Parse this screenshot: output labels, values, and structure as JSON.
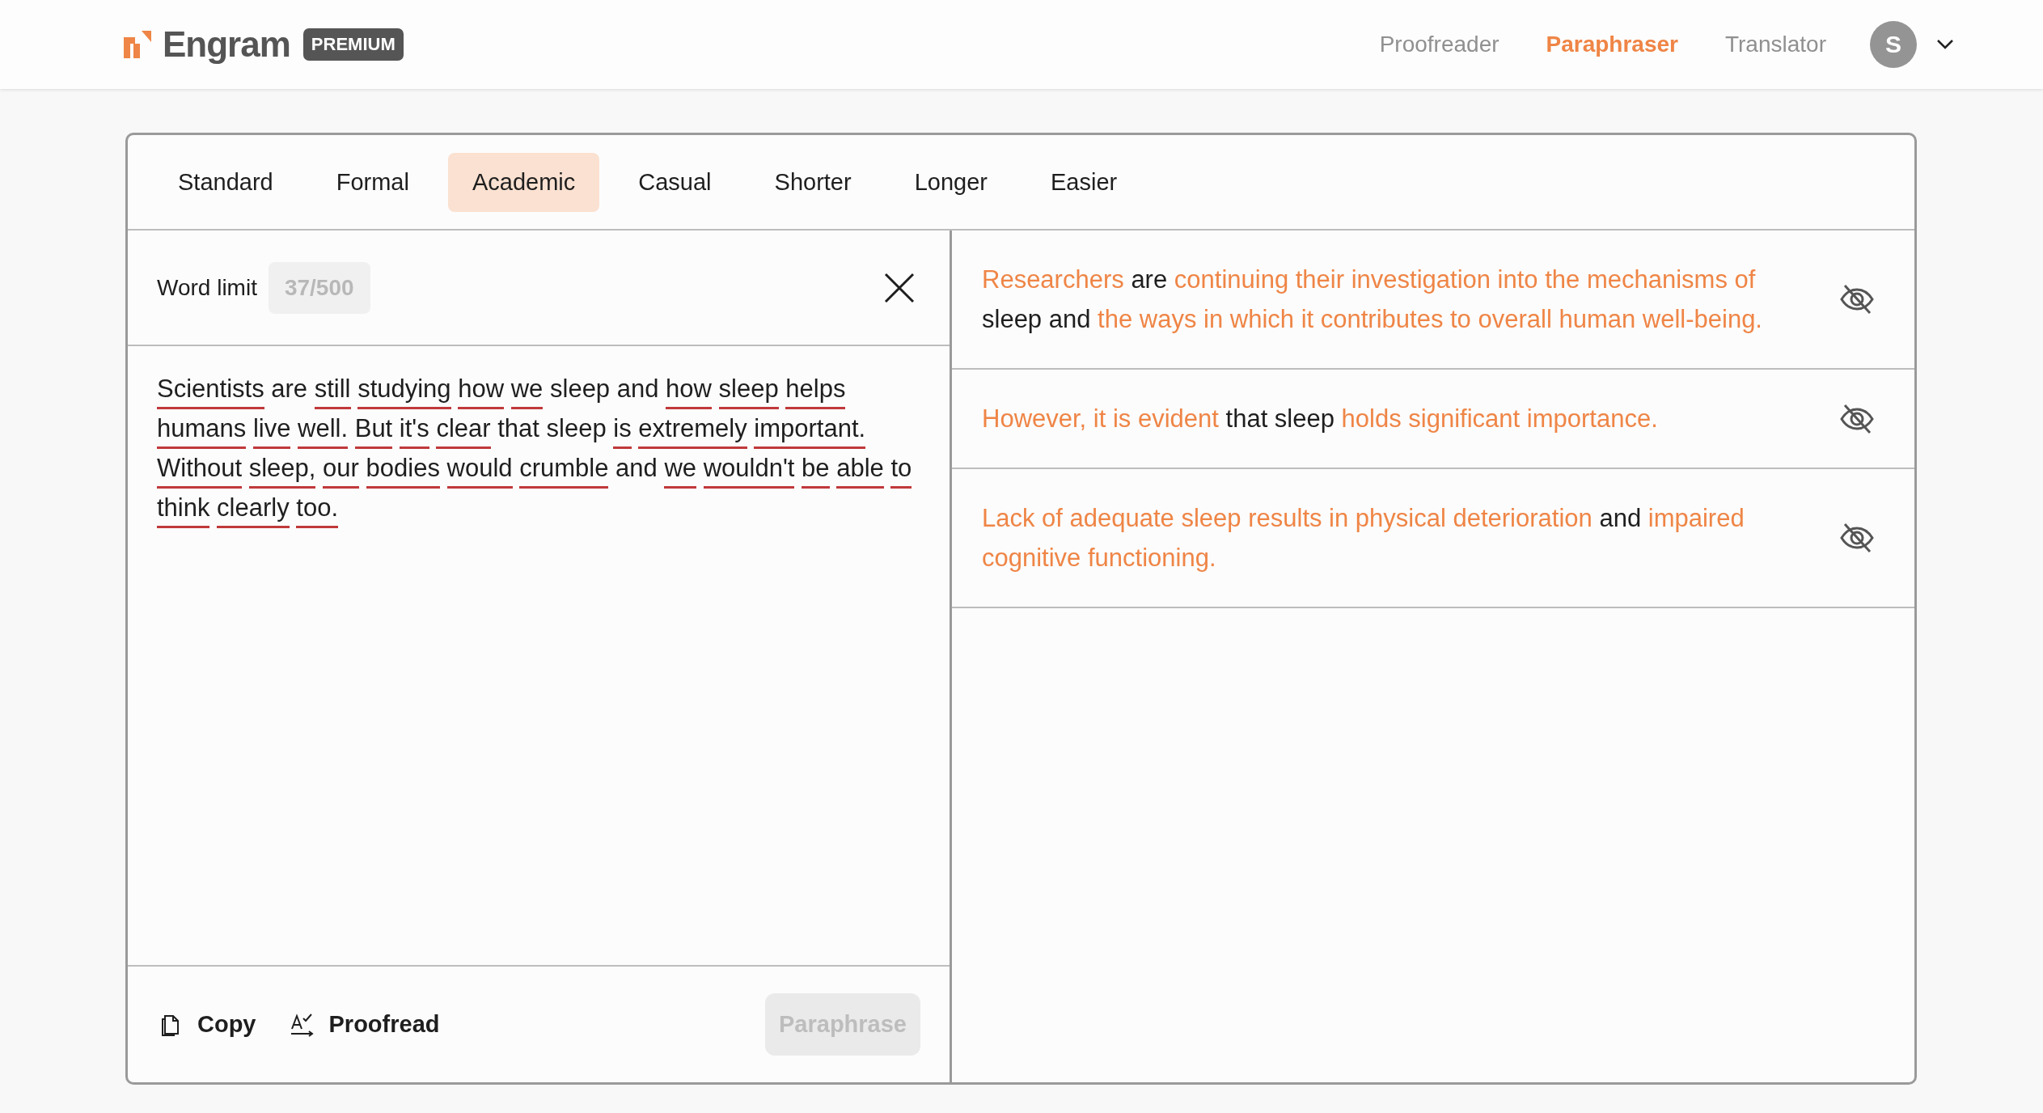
{
  "header": {
    "brand": "Engram",
    "badge": "PREMIUM",
    "nav": [
      {
        "label": "Proofreader",
        "selected": false
      },
      {
        "label": "Paraphraser",
        "selected": true
      },
      {
        "label": "Translator",
        "selected": false
      }
    ],
    "avatar": "S"
  },
  "modes": [
    {
      "label": "Standard",
      "selected": false
    },
    {
      "label": "Formal",
      "selected": false
    },
    {
      "label": "Academic",
      "selected": true
    },
    {
      "label": "Casual",
      "selected": false
    },
    {
      "label": "Shorter",
      "selected": false
    },
    {
      "label": "Longer",
      "selected": false
    },
    {
      "label": "Easier",
      "selected": false
    }
  ],
  "input": {
    "word_limit_label": "Word limit",
    "word_count": "37/500",
    "words": [
      {
        "w": "Scientists",
        "flagged": true
      },
      {
        "w": "are",
        "flagged": false
      },
      {
        "w": "still",
        "flagged": true
      },
      {
        "w": "studying",
        "flagged": true
      },
      {
        "w": "how",
        "flagged": true
      },
      {
        "w": "we",
        "flagged": true
      },
      {
        "w": "sleep",
        "flagged": false
      },
      {
        "w": "and",
        "flagged": false
      },
      {
        "w": "how",
        "flagged": true
      },
      {
        "w": "sleep",
        "flagged": true
      },
      {
        "w": "helps",
        "flagged": true
      },
      {
        "w": "humans",
        "flagged": true
      },
      {
        "w": "live",
        "flagged": true
      },
      {
        "w": "well.",
        "flagged": true
      },
      {
        "w": "But",
        "flagged": true
      },
      {
        "w": "it's",
        "flagged": true
      },
      {
        "w": "clear",
        "flagged": true
      },
      {
        "w": "that",
        "flagged": false
      },
      {
        "w": "sleep",
        "flagged": false
      },
      {
        "w": "is",
        "flagged": true
      },
      {
        "w": "extremely",
        "flagged": true
      },
      {
        "w": "important.",
        "flagged": true
      },
      {
        "w": "Without",
        "flagged": true
      },
      {
        "w": "sleep,",
        "flagged": true
      },
      {
        "w": "our",
        "flagged": true
      },
      {
        "w": "bodies",
        "flagged": true
      },
      {
        "w": "would",
        "flagged": true
      },
      {
        "w": "crumble",
        "flagged": true
      },
      {
        "w": "and",
        "flagged": false
      },
      {
        "w": "we",
        "flagged": true
      },
      {
        "w": "wouldn't",
        "flagged": true
      },
      {
        "w": "be",
        "flagged": true
      },
      {
        "w": "able",
        "flagged": true
      },
      {
        "w": "to",
        "flagged": true
      },
      {
        "w": "think",
        "flagged": true
      },
      {
        "w": "clearly",
        "flagged": true
      },
      {
        "w": "too.",
        "flagged": true
      }
    ]
  },
  "footer": {
    "copy": "Copy",
    "proofread": "Proofread",
    "paraphrase": {
      "label": "Paraphrase",
      "disabled": true
    }
  },
  "output": [
    {
      "segments": [
        {
          "text": "Researchers",
          "changed": true
        },
        {
          "text": "are",
          "changed": false
        },
        {
          "text": "continuing their investigation into the mechanisms of",
          "changed": true
        },
        {
          "text": "sleep and",
          "changed": false
        },
        {
          "text": "the ways in which it contributes to overall human well-being.",
          "changed": true
        }
      ]
    },
    {
      "segments": [
        {
          "text": "However, it is evident",
          "changed": true
        },
        {
          "text": "that sleep",
          "changed": false
        },
        {
          "text": "holds significant importance.",
          "changed": true
        }
      ]
    },
    {
      "segments": [
        {
          "text": "Lack of adequate sleep results in physical deterioration",
          "changed": true
        },
        {
          "text": "and",
          "changed": false
        },
        {
          "text": "impaired cognitive functioning.",
          "changed": true
        }
      ]
    }
  ]
}
